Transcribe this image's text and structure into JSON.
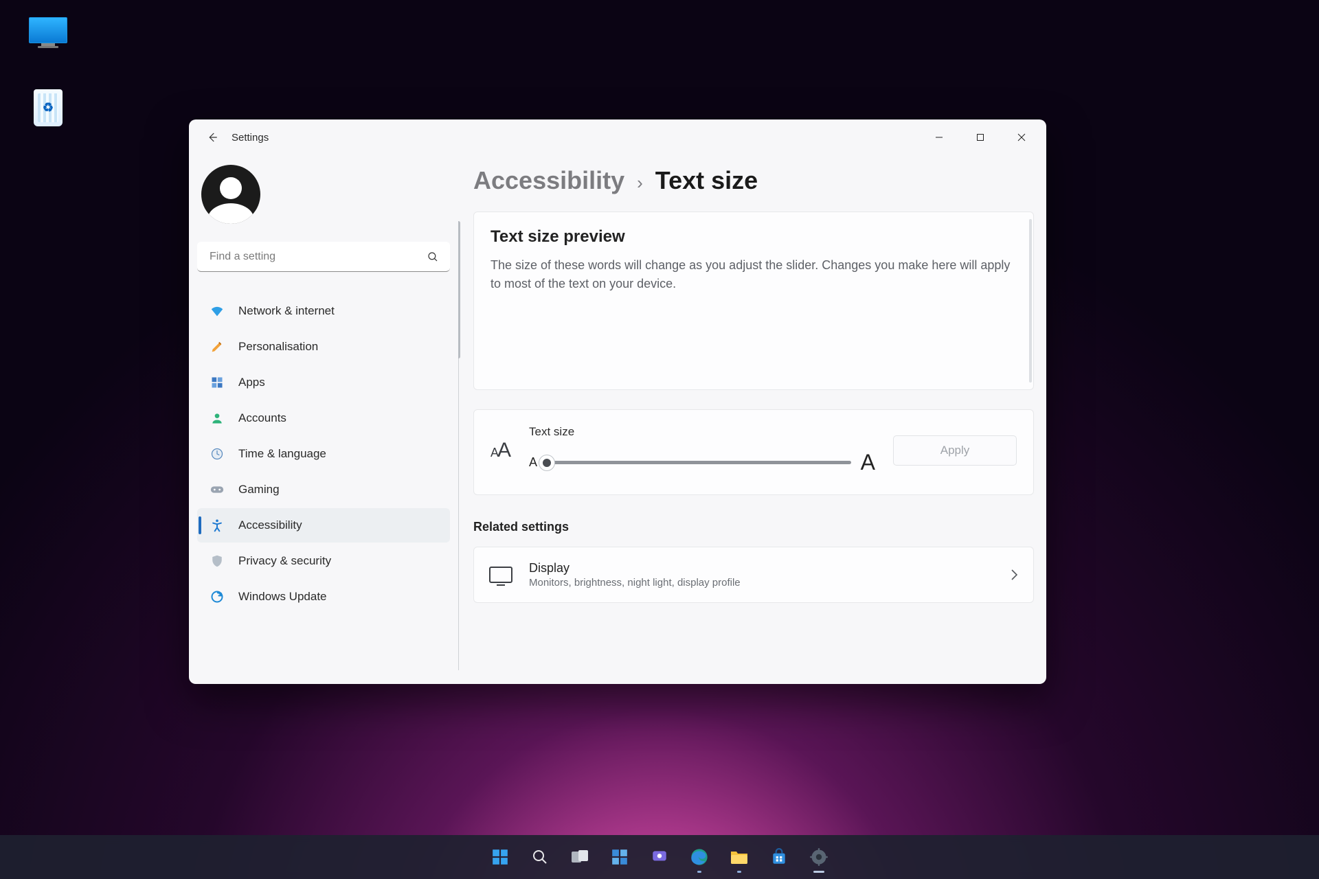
{
  "window": {
    "title": "Settings",
    "breadcrumb": {
      "parent": "Accessibility",
      "current": "Text size"
    }
  },
  "search": {
    "placeholder": "Find a setting"
  },
  "sidebar": {
    "items": [
      {
        "id": "network",
        "label": "Network & internet"
      },
      {
        "id": "personal",
        "label": "Personalisation"
      },
      {
        "id": "apps",
        "label": "Apps"
      },
      {
        "id": "accounts",
        "label": "Accounts"
      },
      {
        "id": "timelang",
        "label": "Time & language"
      },
      {
        "id": "gaming",
        "label": "Gaming"
      },
      {
        "id": "access",
        "label": "Accessibility"
      },
      {
        "id": "privacy",
        "label": "Privacy & security"
      },
      {
        "id": "update",
        "label": "Windows Update"
      }
    ]
  },
  "preview": {
    "heading": "Text size preview",
    "body": "The size of these words will change as you adjust the slider. Changes you make here will apply to most of the text on your device."
  },
  "slider": {
    "label": "Text size",
    "min_glyph": "A",
    "max_glyph": "A",
    "apply": "Apply"
  },
  "related": {
    "heading": "Related settings",
    "display": {
      "title": "Display",
      "sub": "Monitors, brightness, night light, display profile"
    }
  }
}
